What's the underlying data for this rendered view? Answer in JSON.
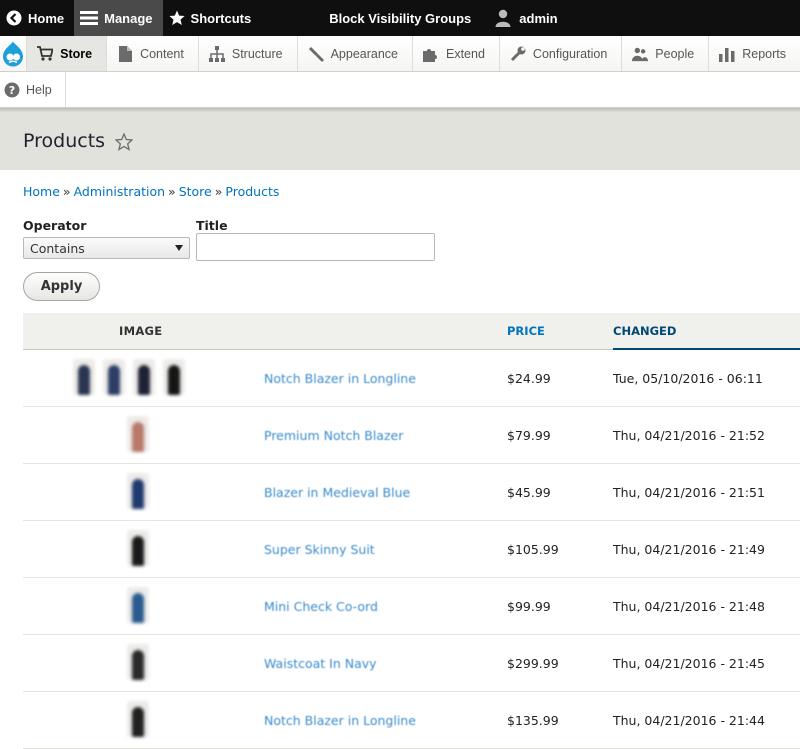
{
  "toolbar": {
    "home": "Home",
    "manage": "Manage",
    "shortcuts": "Shortcuts",
    "block_visibility": "Block Visibility Groups",
    "user": "admin"
  },
  "tray": {
    "items": [
      {
        "label": "Store",
        "icon": "cart-icon"
      },
      {
        "label": "Content",
        "icon": "page-icon"
      },
      {
        "label": "Structure",
        "icon": "structure-icon"
      },
      {
        "label": "Appearance",
        "icon": "brush-icon"
      },
      {
        "label": "Extend",
        "icon": "puzzle-icon"
      },
      {
        "label": "Configuration",
        "icon": "wrench-icon"
      },
      {
        "label": "People",
        "icon": "people-icon"
      },
      {
        "label": "Reports",
        "icon": "bars-icon"
      }
    ],
    "help": "Help"
  },
  "page": {
    "title": "Products"
  },
  "breadcrumb": [
    "Home",
    "Administration",
    "Store",
    "Products"
  ],
  "filters": {
    "operator_label": "Operator",
    "operator_value": "Contains",
    "title_label": "Title",
    "title_value": "",
    "apply": "Apply"
  },
  "table": {
    "headers": {
      "image": "IMAGE",
      "price": "PRICE",
      "changed": "CHANGED"
    },
    "rows": [
      {
        "title": "Notch Blazer in Longline",
        "price": "$24.99",
        "changed": "Tue, 05/10/2016 - 06:11",
        "thumbs": 4
      },
      {
        "title": "Premium Notch Blazer",
        "price": "$79.99",
        "changed": "Thu, 04/21/2016 - 21:52",
        "thumbs": 1
      },
      {
        "title": "Blazer in Medieval Blue",
        "price": "$45.99",
        "changed": "Thu, 04/21/2016 - 21:51",
        "thumbs": 1
      },
      {
        "title": "Super Skinny Suit",
        "price": "$105.99",
        "changed": "Thu, 04/21/2016 - 21:49",
        "thumbs": 1
      },
      {
        "title": "Mini Check Co-ord",
        "price": "$99.99",
        "changed": "Thu, 04/21/2016 - 21:48",
        "thumbs": 1
      },
      {
        "title": "Waistcoat In Navy",
        "price": "$299.99",
        "changed": "Thu, 04/21/2016 - 21:45",
        "thumbs": 1
      },
      {
        "title": "Notch Blazer in Longline",
        "price": "$135.99",
        "changed": "Thu, 04/21/2016 - 21:44",
        "thumbs": 1
      }
    ]
  },
  "colors": {
    "link": "#0074bd",
    "toolbar_bg": "#0f0f0f",
    "header_bg": "#e2e2dc"
  }
}
